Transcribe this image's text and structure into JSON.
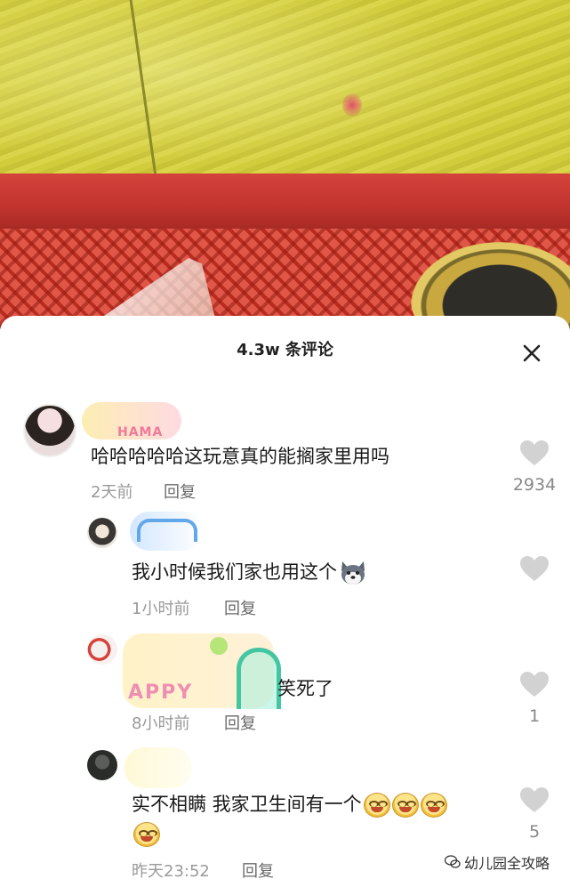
{
  "sheet": {
    "title": "4.3w 条评论"
  },
  "comments": [
    {
      "text": "哈哈哈哈哈这玩意真的能搁家里用吗",
      "name_sticker": "HAMA",
      "time": "2天前",
      "reply_label": "回复",
      "likes": "2934"
    },
    {
      "text": "我小时候我们家也用这个",
      "emoji": "husky-emoji",
      "time": "1小时前",
      "reply_label": "回复",
      "likes": ""
    },
    {
      "text": "笑死了",
      "name_sticker": "APPY",
      "time": "8小时前",
      "reply_label": "回复",
      "likes": "1"
    },
    {
      "text": "实不相瞒 我家卫生间有一个",
      "emoji": "grin-emoji",
      "time": "昨天23:52",
      "reply_label": "回复",
      "likes": "5"
    }
  ],
  "watermark": {
    "text": "幼儿园全攻略"
  },
  "colors": {
    "sheet_bg": "#ffffff",
    "meta_text": "#9a9a9a",
    "heart": "#d2d2d2"
  },
  "icons": [
    "close-icon",
    "heart-icon",
    "wechat-icon"
  ]
}
